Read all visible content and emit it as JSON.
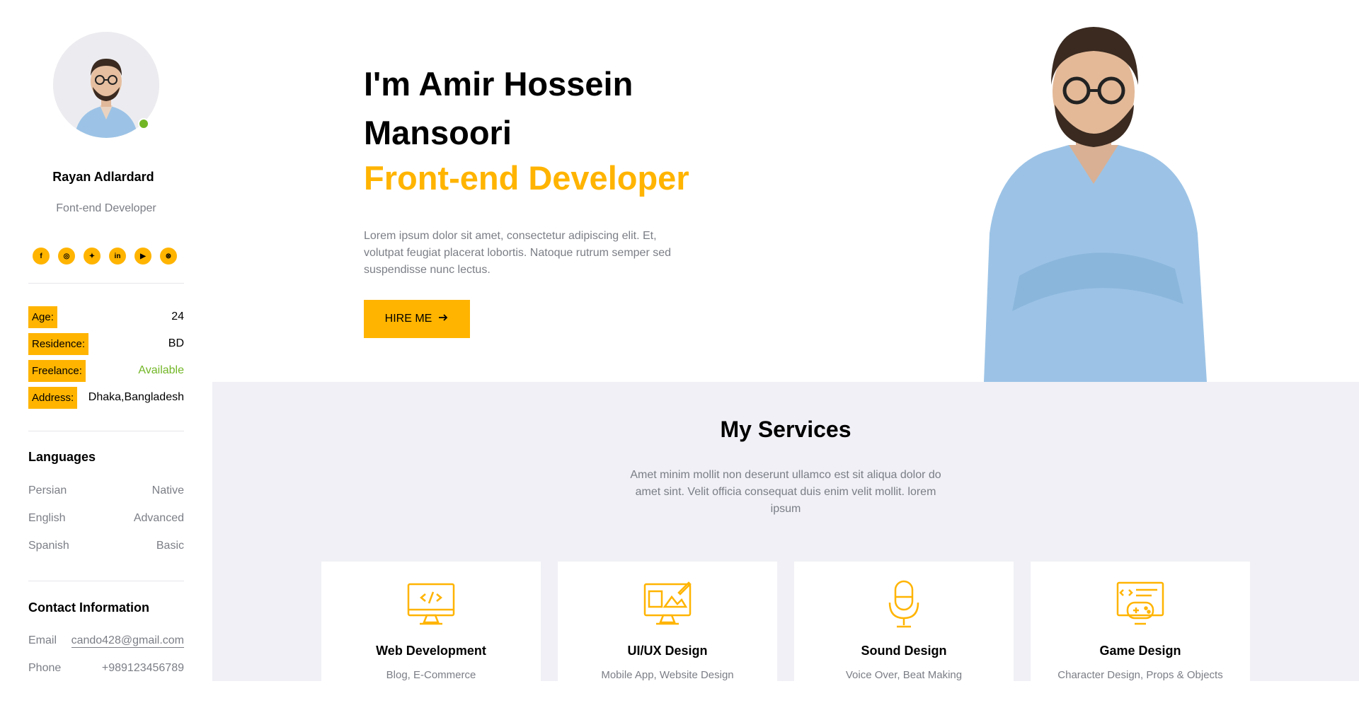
{
  "profile": {
    "name": "Rayan Adlardard",
    "role": "Font-end Developer"
  },
  "socials": [
    {
      "label": "f",
      "icon": "facebook-icon"
    },
    {
      "label": "◎",
      "icon": "instagram-icon"
    },
    {
      "label": "✦",
      "icon": "twitter-icon"
    },
    {
      "label": "in",
      "icon": "linkedin-icon"
    },
    {
      "label": "▶",
      "icon": "youtube-icon"
    },
    {
      "label": "⊛",
      "icon": "dribbble-icon"
    }
  ],
  "info": [
    {
      "label": "Age:",
      "value": "24"
    },
    {
      "label": "Residence:",
      "value": "BD"
    },
    {
      "label": "Freelance:",
      "value": "Available"
    },
    {
      "label": "Address:",
      "value": "Dhaka,Bangladesh"
    }
  ],
  "languages": {
    "title": "Languages",
    "items": [
      {
        "name": "Persian",
        "level": "Native"
      },
      {
        "name": "English",
        "level": "Advanced"
      },
      {
        "name": "Spanish",
        "level": "Basic"
      }
    ]
  },
  "contact": {
    "title": "Contact Information",
    "items": [
      {
        "label": "Email",
        "value": "cando428@gmail.com"
      },
      {
        "label": "Phone",
        "value": "+989123456789"
      }
    ]
  },
  "hero": {
    "heading": "I'm Amir Hossein Mansoori",
    "role": "Front-end Developer",
    "description": "Lorem ipsum dolor sit amet, consectetur adipiscing elit. Et, volutpat feugiat placerat lobortis. Natoque rutrum semper sed suspendisse nunc lectus.",
    "button_label": "HIRE ME"
  },
  "services": {
    "title": "My Services",
    "description": "Amet minim mollit non deserunt ullamco est sit aliqua dolor do amet sint. Velit officia consequat duis enim velit mollit. lorem ipsum",
    "items": [
      {
        "name": "Web Development",
        "sub": "Blog, E-Commerce"
      },
      {
        "name": "UI/UX Design",
        "sub": "Mobile App, Website Design"
      },
      {
        "name": "Sound Design",
        "sub": "Voice Over, Beat Making"
      },
      {
        "name": "Game Design",
        "sub": "Character Design, Props & Objects"
      }
    ]
  },
  "colors": {
    "accent": "#ffb400",
    "available": "#72b626",
    "muted": "#7b7e86",
    "services_bg": "#f0f0f6"
  }
}
